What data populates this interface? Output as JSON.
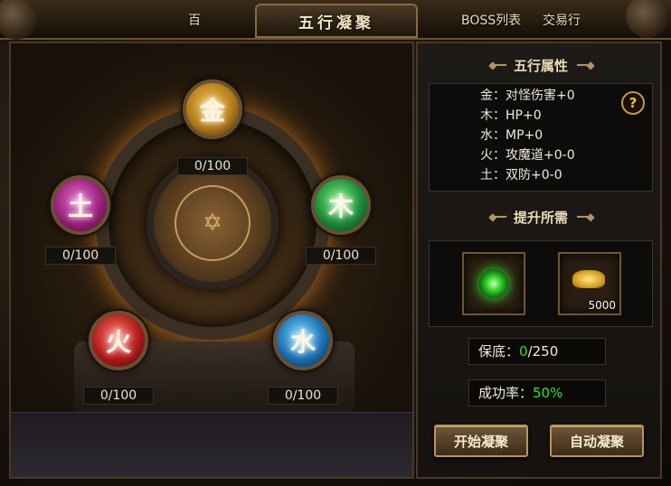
{
  "top_tabs": {
    "left_partial": "百",
    "title": "五行凝聚",
    "boss_list": "BOSS列表",
    "trade": "交易行"
  },
  "wuxing": {
    "metal": {
      "glyph": "金",
      "count": "0/100",
      "color": "#b27a1a"
    },
    "wood": {
      "glyph": "木",
      "count": "0/100",
      "color": "#1a8a3a"
    },
    "water": {
      "glyph": "水",
      "count": "0/100",
      "color": "#1a6fb0"
    },
    "fire": {
      "glyph": "火",
      "count": "0/100",
      "color": "#b01a1a"
    },
    "earth": {
      "glyph": "土",
      "count": "0/100",
      "color": "#9a1f7a"
    }
  },
  "attributes": {
    "title": "五行属性",
    "lines": [
      "金：对怪伤害+0",
      "木：HP+0",
      "水：MP+0",
      "火：攻魔道+0-0",
      "土：双防+0-0"
    ],
    "help": "?"
  },
  "requirements": {
    "title": "提升所需",
    "items": [
      {
        "icon": "green-gem-icon"
      },
      {
        "icon": "gold-coins-icon",
        "qty": "5000"
      }
    ]
  },
  "stats": {
    "guarantee_label": "保底：",
    "guarantee_value": "0",
    "guarantee_max": "/250",
    "rate_label": "成功率：",
    "rate_value": "50%"
  },
  "buttons": {
    "start": "开始凝聚",
    "auto": "自动凝聚"
  }
}
